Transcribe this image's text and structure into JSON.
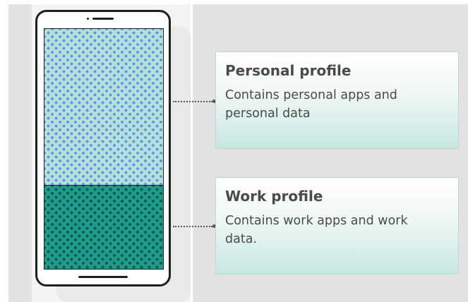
{
  "profiles": {
    "personal": {
      "title": "Personal profile",
      "line1": "Contains personal apps and",
      "line2": "personal data"
    },
    "work": {
      "title": "Work profile",
      "line1": "Contains work apps and work",
      "line2": "data."
    }
  },
  "colors": {
    "personal_area": "#b4e0db",
    "personal_dots": "#5b8ee6",
    "work_area": "#1f9c8b",
    "work_dots": "#0f5a4e",
    "text": "#4a4a4a",
    "phone_outline": "#1f1f1f"
  }
}
